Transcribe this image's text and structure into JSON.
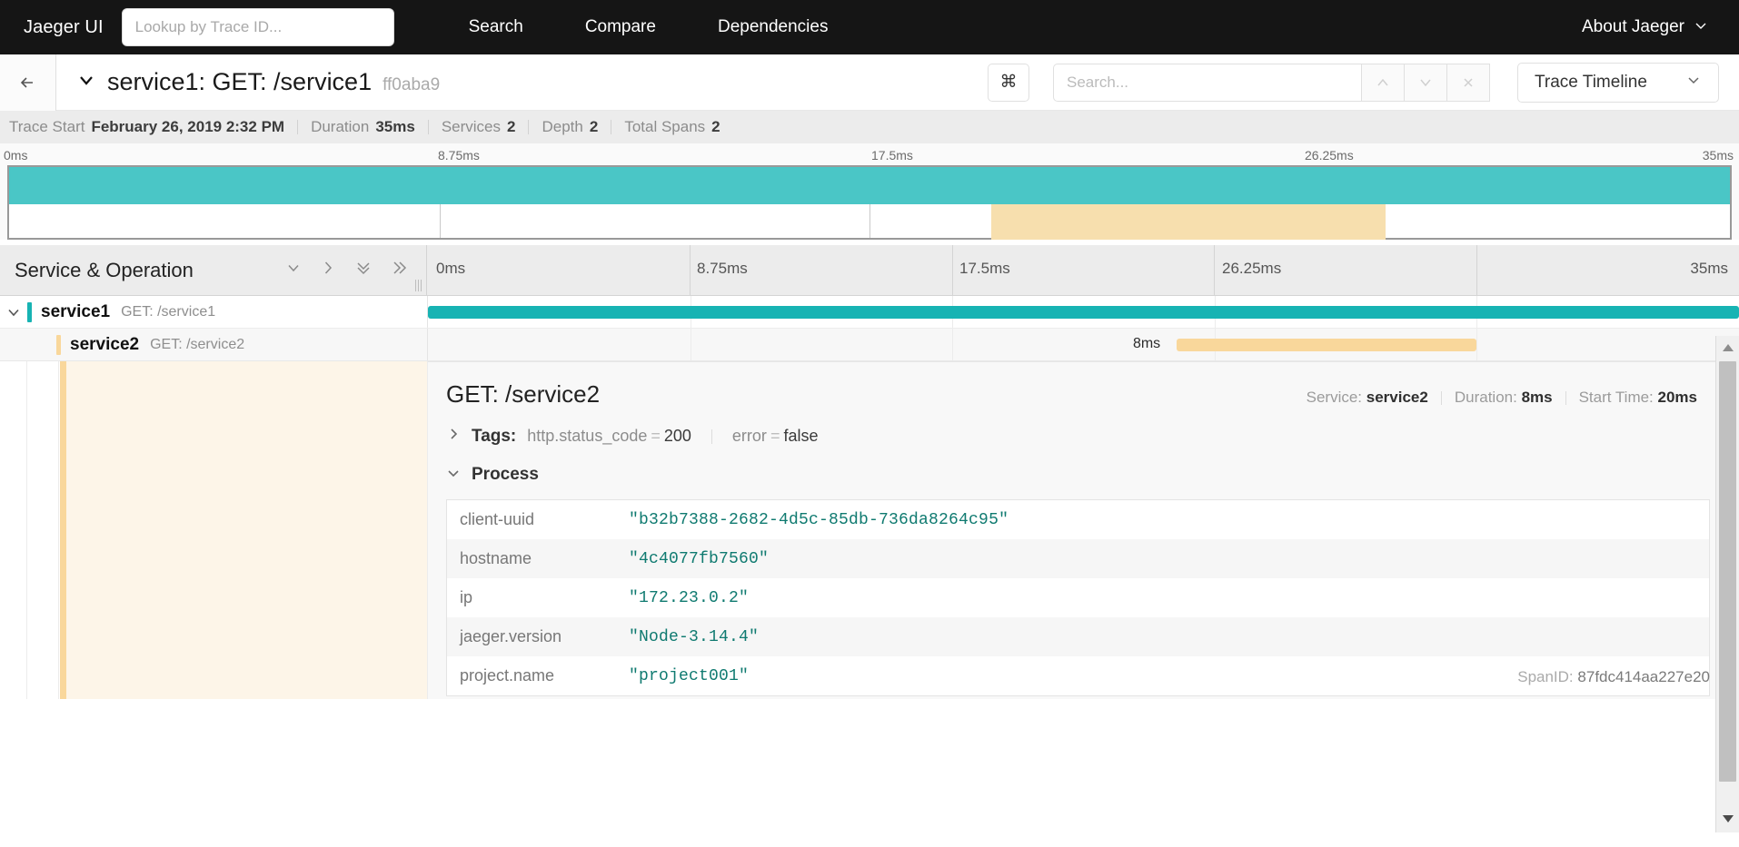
{
  "topnav": {
    "brand": "Jaeger UI",
    "traceid_placeholder": "Lookup by Trace ID...",
    "traceid_value": "",
    "links": [
      {
        "label": "Search"
      },
      {
        "label": "Compare"
      },
      {
        "label": "Dependencies"
      }
    ],
    "about": "About Jaeger",
    "about_caret": "chevron-down-icon"
  },
  "trace_header": {
    "back_icon": "arrow-left-icon",
    "caret_icon": "chevron-down-icon",
    "title": "service1: GET: /service1",
    "short_id": "ff0aba9",
    "kbd_glyph": "⌘",
    "search_placeholder": "Search...",
    "search_value": "",
    "prev_icon": "chevron-up-icon",
    "next_icon": "chevron-down-icon",
    "clear_icon": "close-icon",
    "view_select": "Trace Timeline",
    "view_select_caret": "chevron-down-icon"
  },
  "meta": {
    "trace_start_label": "Trace Start",
    "trace_start_value": "February 26, 2019 2:32 PM",
    "duration_label": "Duration",
    "duration_value": "35ms",
    "services_label": "Services",
    "services_value": "2",
    "depth_label": "Depth",
    "depth_value": "2",
    "total_spans_label": "Total Spans",
    "total_spans_value": "2"
  },
  "minimap": {
    "ticks": [
      "0ms",
      "8.75ms",
      "17.5ms",
      "26.25ms",
      "35ms"
    ],
    "bars": [
      {
        "name": "service1",
        "color": "#4ac6c6",
        "start_pct": 0,
        "width_pct": 100
      },
      {
        "name": "service2",
        "color": "#f7dfae",
        "start_pct": 57.1,
        "width_pct": 22.9
      }
    ]
  },
  "columns": {
    "title": "Service & Operation",
    "icons": [
      "chevron-down-icon",
      "chevron-right-icon",
      "double-chevron-down-icon",
      "double-chevron-right-icon"
    ],
    "ruler_ticks": [
      "0ms",
      "8.75ms",
      "17.5ms",
      "26.25ms",
      "35ms"
    ]
  },
  "spans": [
    {
      "caret": "chevron-down-icon",
      "color": "#17b3b3",
      "service": "service1",
      "operation": "GET: /service1",
      "bar_start_pct": 0,
      "bar_width_pct": 100,
      "bar_label": ""
    },
    {
      "caret": "",
      "color": "#f9d79b",
      "service": "service2",
      "operation": "GET: /service2",
      "bar_start_pct": 57.1,
      "bar_width_pct": 22.9,
      "bar_label": "8ms"
    }
  ],
  "detail": {
    "operation": "GET: /service2",
    "service_label": "Service:",
    "service_value": "service2",
    "duration_label": "Duration:",
    "duration_value": "8ms",
    "start_time_label": "Start Time:",
    "start_time_value": "20ms",
    "tags_caret": "chevron-right-icon",
    "tags_label": "Tags:",
    "tags": [
      {
        "key": "http.status_code",
        "eq": "=",
        "value": "200"
      },
      {
        "key": "error",
        "eq": "=",
        "value": "false"
      }
    ],
    "process_caret": "chevron-down-icon",
    "process_label": "Process",
    "process_rows": [
      {
        "key": "client-uuid",
        "value": "\"b32b7388-2682-4d5c-85db-736da8264c95\""
      },
      {
        "key": "hostname",
        "value": "\"4c4077fb7560\""
      },
      {
        "key": "ip",
        "value": "\"172.23.0.2\""
      },
      {
        "key": "jaeger.version",
        "value": "\"Node-3.14.4\""
      },
      {
        "key": "project.name",
        "value": "\"project001\""
      }
    ],
    "spanid_label": "SpanID:",
    "spanid_value": "87fdc414aa227e20"
  },
  "scrollbar": {
    "up_icon": "triangle-up-icon",
    "down_icon": "triangle-down-icon"
  },
  "colors": {
    "teal": "#17b3b3",
    "minimap_teal": "#4ac6c6",
    "amber": "#f9d79b",
    "detail_bg": "#fdf5e8",
    "value_green": "#0f7a70",
    "navbar": "#151515"
  }
}
